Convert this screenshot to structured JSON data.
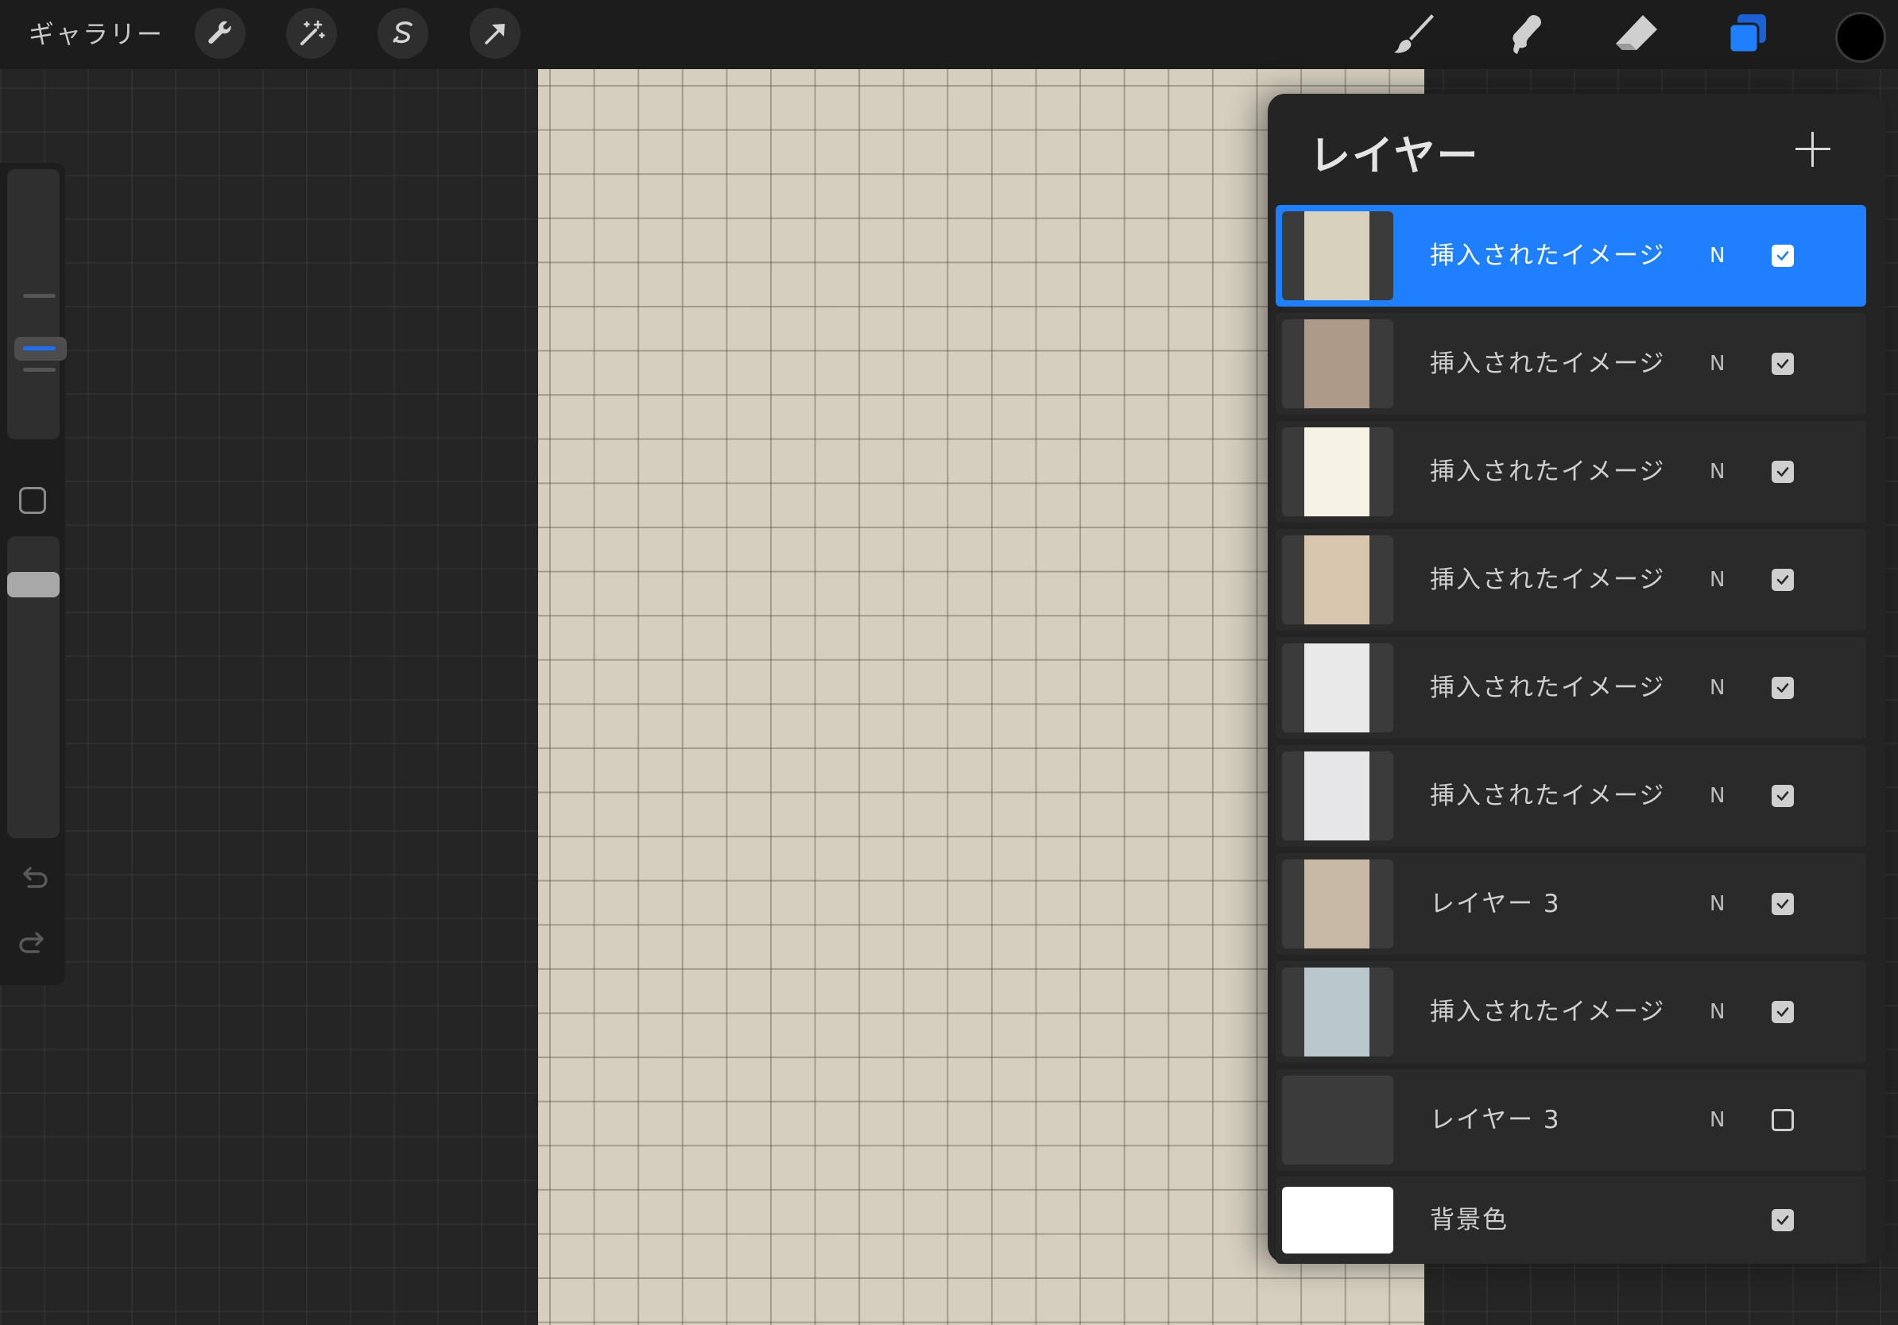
{
  "topbar": {
    "gallery_label": "ギャラリー",
    "tools_left": [
      {
        "name": "actions-icon"
      },
      {
        "name": "adjustments-icon"
      },
      {
        "name": "selection-icon"
      },
      {
        "name": "transform-icon"
      }
    ],
    "tools_right": [
      {
        "name": "brush-icon"
      },
      {
        "name": "smudge-icon"
      },
      {
        "name": "eraser-icon"
      },
      {
        "name": "layers-icon",
        "active": true
      }
    ],
    "current_color": "#000000",
    "accent_color": "#1f80ff"
  },
  "sidebar": {
    "undo": "undo-icon",
    "redo": "redo-icon"
  },
  "layers_panel": {
    "title": "レイヤー",
    "add_button": "plus-icon",
    "layers": [
      {
        "name": "挿入されたイメージ",
        "blend": "N",
        "visible": true,
        "selected": true,
        "thumb": "#d8d1be"
      },
      {
        "name": "挿入されたイメージ",
        "blend": "N",
        "visible": true,
        "selected": false,
        "thumb": "#ad9a88"
      },
      {
        "name": "挿入されたイメージ",
        "blend": "N",
        "visible": true,
        "selected": false,
        "thumb": "#f6f2e4"
      },
      {
        "name": "挿入されたイメージ",
        "blend": "N",
        "visible": true,
        "selected": false,
        "thumb": "#d9c6ae"
      },
      {
        "name": "挿入されたイメージ",
        "blend": "N",
        "visible": true,
        "selected": false,
        "thumb": "#e9e9ea"
      },
      {
        "name": "挿入されたイメージ",
        "blend": "N",
        "visible": true,
        "selected": false,
        "thumb": "#e6e6e8"
      },
      {
        "name": "レイヤー 3",
        "blend": "N",
        "visible": true,
        "selected": false,
        "thumb": "#c8b9a4"
      },
      {
        "name": "挿入されたイメージ",
        "blend": "N",
        "visible": true,
        "selected": false,
        "thumb": "#b9c8cd"
      },
      {
        "name": "レイヤー 3",
        "blend": "N",
        "visible": false,
        "selected": false,
        "thumb": "#3b3b3b"
      }
    ],
    "background_layer": {
      "name": "背景色",
      "visible": true,
      "color": "#ffffff"
    }
  }
}
